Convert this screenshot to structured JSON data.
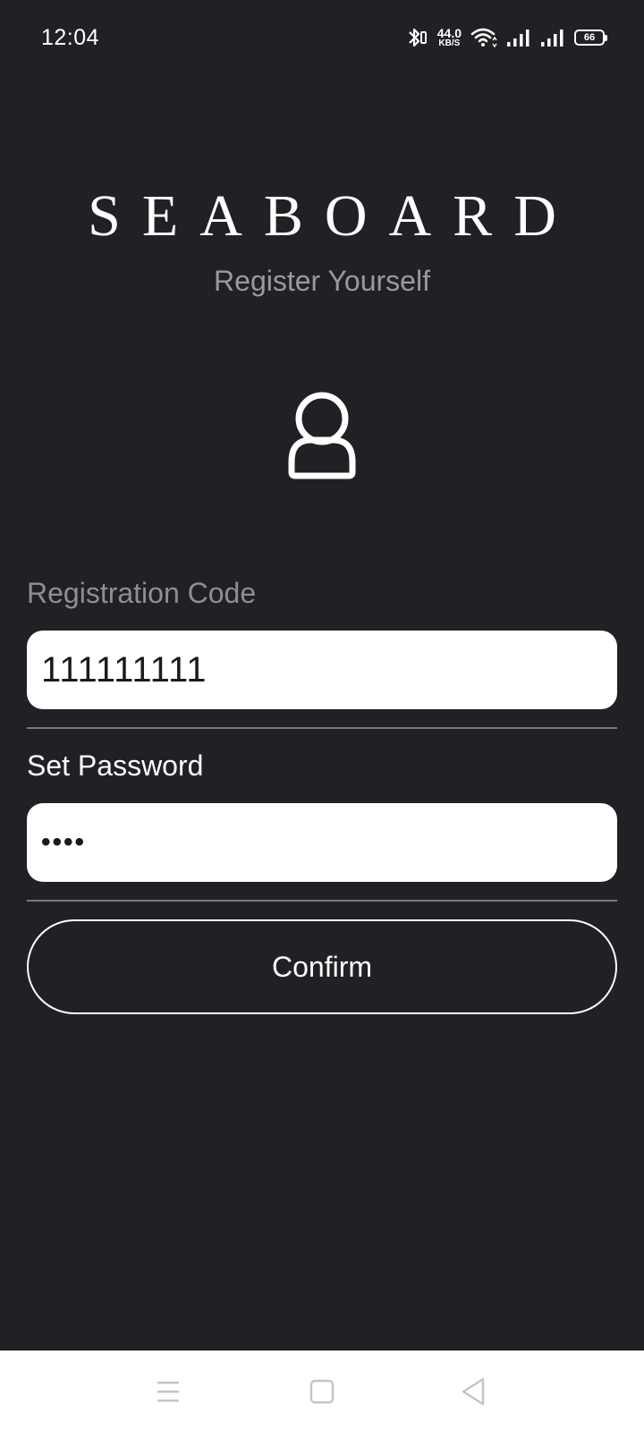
{
  "status_bar": {
    "time": "12:04",
    "net_speed_value": "44.0",
    "net_speed_unit": "KB/S",
    "battery_level": "66",
    "icons": [
      "bluetooth-icon",
      "wifi-icon",
      "signal-icon",
      "signal-icon",
      "battery-icon"
    ]
  },
  "brand": {
    "title": "SEABOARD",
    "subtitle": "Register Yourself"
  },
  "form": {
    "code_label": "Registration Code",
    "code_value": "111111111",
    "password_label": "Set Password",
    "password_value": "••••",
    "confirm_label": "Confirm"
  },
  "nav_bar": {
    "icons": [
      "menu-icon",
      "home-icon",
      "back-icon"
    ]
  },
  "colors": {
    "background": "#212125",
    "text": "#ffffff",
    "muted_text": "#8f8f93",
    "input_bg": "#ffffff"
  }
}
